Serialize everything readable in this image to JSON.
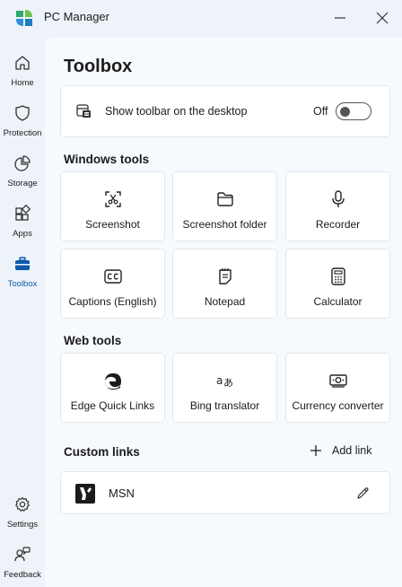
{
  "app": {
    "title": "PC Manager",
    "brand_colors": [
      "#2ba96b",
      "#2b8fd9",
      "#6cc24a"
    ]
  },
  "sidebar": {
    "items": [
      {
        "label": "Home",
        "icon": "home-icon"
      },
      {
        "label": "Protection",
        "icon": "shield-icon"
      },
      {
        "label": "Storage",
        "icon": "pie-chart-icon"
      },
      {
        "label": "Apps",
        "icon": "apps-grid-icon"
      },
      {
        "label": "Toolbox",
        "icon": "toolbox-icon",
        "active": true
      },
      {
        "label": "Settings",
        "icon": "gear-icon"
      },
      {
        "label": "Feedback",
        "icon": "feedback-icon"
      }
    ],
    "accent_color": "#0f5aa8"
  },
  "main": {
    "title": "Toolbox",
    "toolbar_setting": {
      "label": "Show toolbar on the desktop",
      "state": "Off"
    },
    "windows_tools": {
      "title": "Windows tools",
      "items": [
        {
          "label": "Screenshot",
          "icon": "screenshot-icon"
        },
        {
          "label": "Screenshot folder",
          "icon": "folder-icon"
        },
        {
          "label": "Recorder",
          "icon": "microphone-icon"
        },
        {
          "label": "Captions (English)",
          "icon": "captions-icon"
        },
        {
          "label": "Notepad",
          "icon": "notepad-icon"
        },
        {
          "label": "Calculator",
          "icon": "calculator-icon"
        }
      ]
    },
    "web_tools": {
      "title": "Web tools",
      "items": [
        {
          "label": "Edge Quick Links",
          "icon": "edge-icon"
        },
        {
          "label": "Bing translator",
          "icon": "translator-icon"
        },
        {
          "label": "Currency converter",
          "icon": "currency-icon"
        }
      ]
    },
    "custom_links": {
      "title": "Custom links",
      "add_label": "Add link",
      "items": [
        {
          "label": "MSN",
          "icon": "msn-logo"
        }
      ]
    }
  }
}
